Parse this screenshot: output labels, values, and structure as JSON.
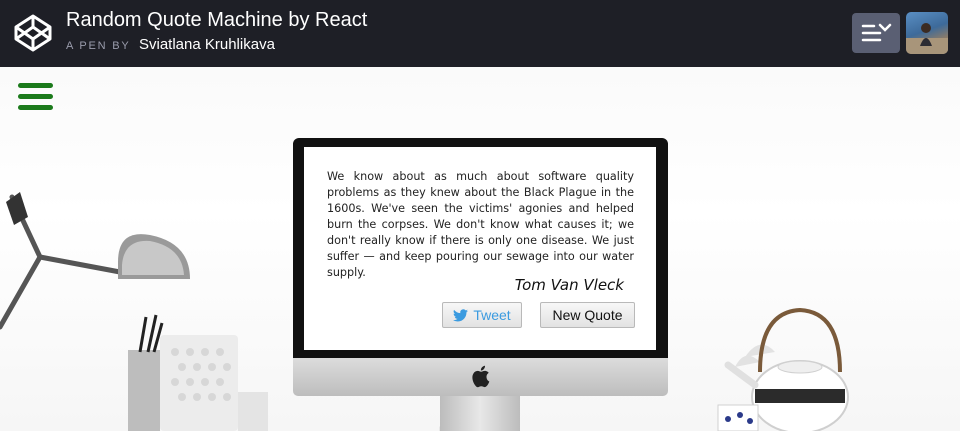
{
  "header": {
    "title": "Random Quote Machine by React",
    "pen_by": "A PEN BY",
    "author": "Sviatlana Kruhlikava"
  },
  "quote": {
    "text": "We know about as much about software quality problems as they knew about the Black Plague in the 1600s. We've seen the victims' agonies and helped burn the corpses. We don't know what causes it; we don't really know if there is only one disease. We just suffer — and keep pouring our sewage into our water supply.",
    "author": "Tom Van Vleck"
  },
  "buttons": {
    "tweet": "Tweet",
    "new_quote": "New Quote"
  },
  "colors": {
    "header_bg": "#1e1f26",
    "hamburger": "#1b7a1b",
    "tweet": "#3b9be0"
  },
  "icons": [
    "codepen-logo-icon",
    "view-switcher-icon",
    "hamburger-menu-icon",
    "twitter-bird-icon",
    "apple-logo-icon"
  ]
}
